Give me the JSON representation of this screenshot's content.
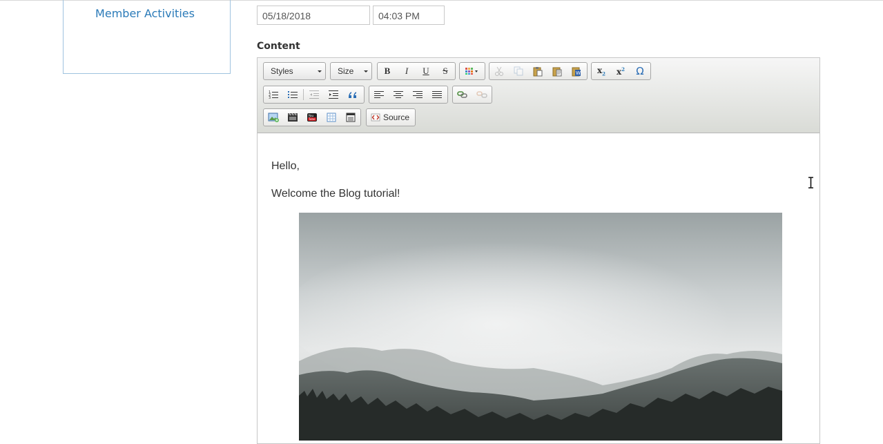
{
  "sidebar": {
    "link_label": "Member Activities"
  },
  "form": {
    "date_value": "05/18/2018",
    "time_value": "04:03 PM",
    "content_label": "Content"
  },
  "editor": {
    "toolbar": {
      "styles_label": "Styles",
      "size_label": "Size",
      "bold_label": "B",
      "italic_label": "I",
      "underline_label": "U",
      "strike_label": "S",
      "subscript_label": "x",
      "superscript_label": "x",
      "special_char_label": "Ω",
      "source_label": "Source"
    },
    "body": {
      "greeting": "Hello,",
      "welcome": "Welcome the Blog tutorial!"
    }
  },
  "icons": {
    "text_color": "text-color-icon",
    "cut": "cut-icon",
    "copy": "copy-icon",
    "paste": "paste-icon",
    "paste_text": "paste-text-icon",
    "paste_word": "paste-word-icon",
    "numbered_list": "numbered-list-icon",
    "bulleted_list": "bulleted-list-icon",
    "outdent": "outdent-icon",
    "indent": "indent-icon",
    "blockquote": "blockquote-icon",
    "align_left": "align-left-icon",
    "align_center": "align-center-icon",
    "align_right": "align-right-icon",
    "justify": "justify-icon",
    "link": "link-icon",
    "unlink": "unlink-icon",
    "image": "image-icon",
    "video": "video-icon",
    "youtube": "youtube-icon",
    "table": "table-icon",
    "horizontal_rule": "template-icon"
  },
  "colors": {
    "link": "#2a7ab8",
    "sidebar_border": "#9fc3df"
  }
}
